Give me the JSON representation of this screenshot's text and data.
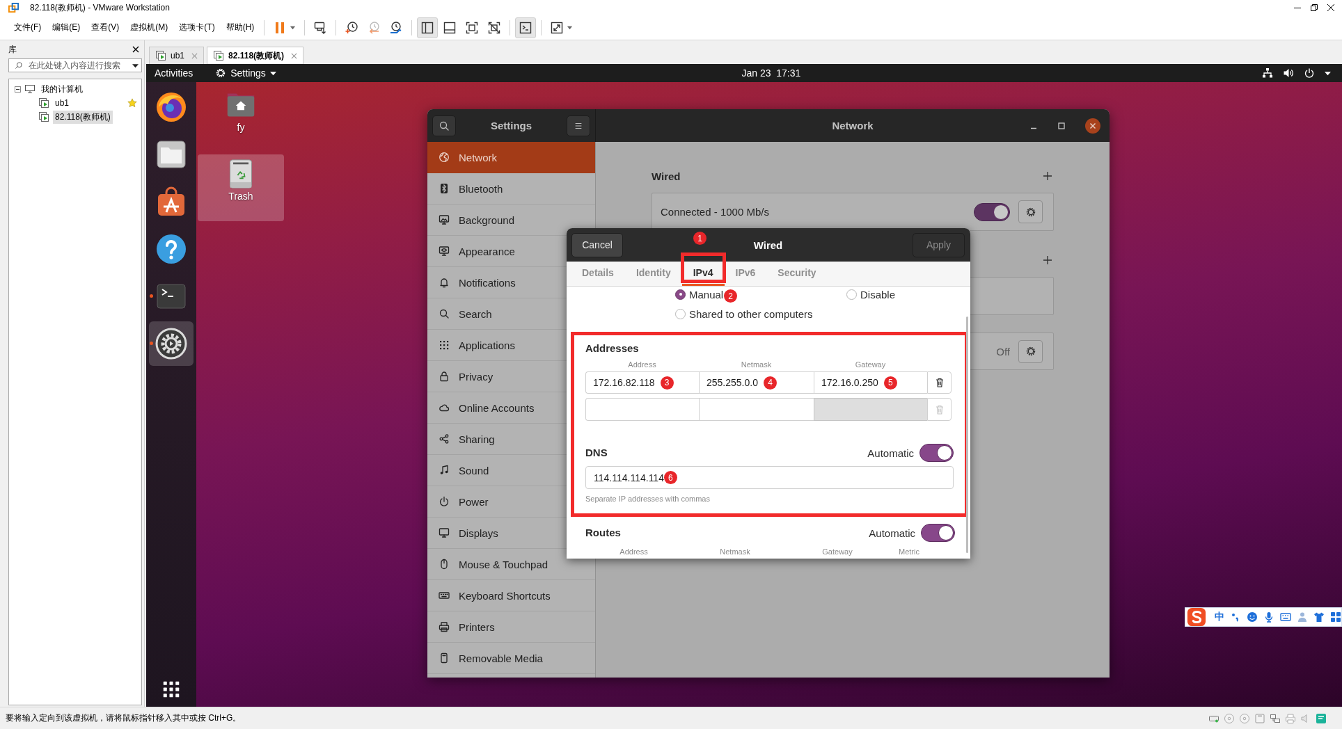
{
  "vmware": {
    "title": "82.118(教师机) - VMware Workstation",
    "menu": [
      {
        "label": "文件(F)"
      },
      {
        "label": "编辑(E)"
      },
      {
        "label": "查看(V)"
      },
      {
        "label": "虚拟机(M)"
      },
      {
        "label": "选项卡(T)"
      },
      {
        "label": "帮助(H)"
      }
    ],
    "toolbar": [
      [
        {
          "kind": "pause",
          "pressed": false,
          "menu": true
        }
      ],
      [
        {
          "kind": "send-keys",
          "pressed": false,
          "menu": false
        }
      ],
      [
        {
          "kind": "snapshot",
          "pressed": false,
          "menu": false
        },
        {
          "kind": "revert",
          "pressed": false,
          "menu": false
        },
        {
          "kind": "snapshot-manager",
          "pressed": false,
          "menu": false
        }
      ],
      [
        {
          "kind": "library",
          "pressed": true,
          "menu": false
        },
        {
          "kind": "thumbnails",
          "pressed": false,
          "menu": false
        },
        {
          "kind": "fullscreen",
          "pressed": false,
          "menu": false
        },
        {
          "kind": "unity",
          "pressed": false,
          "menu": false
        }
      ],
      [
        {
          "kind": "console",
          "pressed": true,
          "menu": false
        }
      ],
      [
        {
          "kind": "stretch",
          "pressed": false,
          "menu": true
        }
      ]
    ],
    "library": {
      "title": "库",
      "search_placeholder": "在此处键入内容进行搜索",
      "tree": [
        {
          "label": "我的计算机",
          "expanded": true,
          "children": [
            {
              "label": "ub1",
              "favorite": true,
              "selected": false
            },
            {
              "label": "82.118(教师机)",
              "favorite": false,
              "selected": true
            }
          ]
        }
      ]
    },
    "tabs": [
      {
        "label": "ub1",
        "selected": false
      },
      {
        "label": "82.118(教师机)",
        "selected": true
      }
    ],
    "status_bar": {
      "message": "要将输入定向到该虚拟机，请将鼠标指针移入其中或按 Ctrl+G。"
    }
  },
  "guest": {
    "top_bar": {
      "activities": "Activities",
      "app_menu": "Settings",
      "clock": "Jan 23  17:31"
    },
    "dock": [
      {
        "kind": "browser",
        "running": false,
        "focused": false
      },
      {
        "kind": "files",
        "running": false,
        "focused": false
      },
      {
        "kind": "software",
        "running": false,
        "focused": false
      },
      {
        "kind": "help",
        "running": false,
        "focused": false
      },
      {
        "kind": "terminal",
        "running": true,
        "focused": false
      },
      {
        "kind": "settings",
        "running": true,
        "focused": true
      }
    ],
    "desktop_icons": [
      {
        "label": "fy",
        "kind": "home",
        "selected": false
      },
      {
        "label": "Trash",
        "kind": "trash",
        "selected": true
      }
    ],
    "settings": {
      "title": "Settings",
      "panel_title": "Network",
      "sidebar": [
        {
          "label": "Network",
          "kind": "network",
          "selected": true
        },
        {
          "label": "Bluetooth",
          "kind": "bluetooth",
          "selected": false
        },
        {
          "label": "Background",
          "kind": "background",
          "selected": false
        },
        {
          "label": "Appearance",
          "kind": "appearance",
          "selected": false
        },
        {
          "label": "Notifications",
          "kind": "notifications",
          "selected": false
        },
        {
          "label": "Search",
          "kind": "search",
          "selected": false
        },
        {
          "label": "Applications",
          "kind": "applications",
          "selected": false
        },
        {
          "label": "Privacy",
          "kind": "privacy",
          "selected": false
        },
        {
          "label": "Online Accounts",
          "kind": "online-accounts",
          "selected": false
        },
        {
          "label": "Sharing",
          "kind": "sharing",
          "selected": false
        },
        {
          "label": "Sound",
          "kind": "sound",
          "selected": false
        },
        {
          "label": "Power",
          "kind": "power",
          "selected": false
        },
        {
          "label": "Displays",
          "kind": "displays",
          "selected": false
        },
        {
          "label": "Mouse & Touchpad",
          "kind": "mouse",
          "selected": false
        },
        {
          "label": "Keyboard Shortcuts",
          "kind": "keyboard",
          "selected": false
        },
        {
          "label": "Printers",
          "kind": "printers",
          "selected": false
        },
        {
          "label": "Removable Media",
          "kind": "removable-media",
          "selected": false
        }
      ],
      "wired": {
        "heading": "Wired",
        "status": "Connected - 1000 Mb/s",
        "on": true
      },
      "proxy": {
        "value": "Off"
      },
      "dialog": {
        "cancel": "Cancel",
        "title": "Wired",
        "apply": {
          "label": "Apply",
          "disabled": true
        },
        "tabs": [
          {
            "label": "Details",
            "selected": false,
            "highlighted": false
          },
          {
            "label": "Identity",
            "selected": false,
            "highlighted": false
          },
          {
            "label": "IPv4",
            "selected": true,
            "highlighted": true,
            "badge": "1"
          },
          {
            "label": "IPv6",
            "selected": false,
            "highlighted": false
          },
          {
            "label": "Security",
            "selected": false,
            "highlighted": false
          }
        ],
        "methods": [
          {
            "label": "Manual",
            "selected": true,
            "badge": "2"
          },
          {
            "label": "Disable",
            "selected": false
          },
          {
            "label": "Shared to other computers",
            "selected": false
          }
        ],
        "boxed": true,
        "addresses": {
          "heading": "Addresses",
          "columns": [
            "Address",
            "Netmask",
            "Gateway"
          ],
          "rows": [
            {
              "removable": true,
              "cells": [
                {
                  "value": "172.16.82.118",
                  "badge": "3",
                  "disabled": false
                },
                {
                  "value": "255.255.0.0",
                  "badge": "4",
                  "disabled": false
                },
                {
                  "value": "172.16.0.250",
                  "badge": "5",
                  "disabled": false
                }
              ]
            },
            {
              "removable": false,
              "cells": [
                {
                  "disabled": false
                },
                {
                  "disabled": false
                },
                {
                  "disabled": true
                }
              ]
            }
          ]
        },
        "dns": {
          "heading": "DNS",
          "automatic_label": "Automatic",
          "automatic": true,
          "value": "114.114.114.114",
          "badge": "6",
          "hint": "Separate IP addresses with commas"
        },
        "routes": {
          "heading": "Routes",
          "automatic_label": "Automatic",
          "automatic": true,
          "columns": [
            "Address",
            "Netmask",
            "Gateway",
            "Metric"
          ]
        }
      }
    },
    "ime_bar": {
      "mode": "中"
    }
  }
}
